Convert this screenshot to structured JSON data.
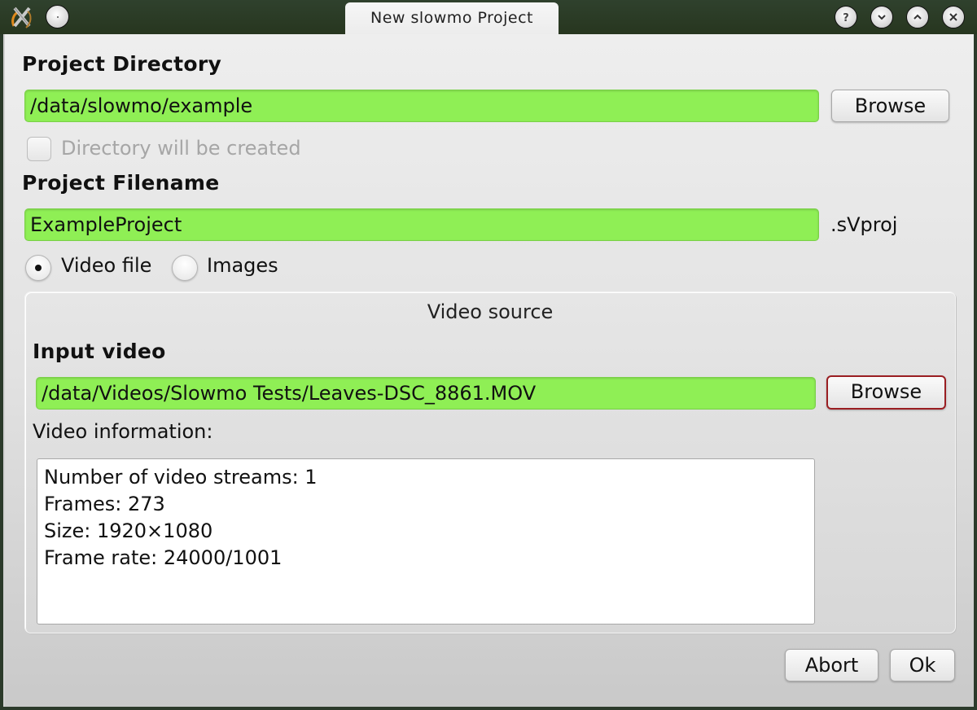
{
  "window": {
    "title": "New slowmo Project",
    "icons": {
      "app": "slowmo-app-logo-icon",
      "menu": "window-menu-icon",
      "help": "help-icon",
      "minimize": "minimize-icon",
      "maximize": "maximize-icon",
      "close": "close-icon"
    }
  },
  "project_directory": {
    "label": "Project Directory",
    "value": "/data/slowmo/example",
    "browse_label": "Browse",
    "create_checkbox": {
      "label": "Directory will be created",
      "checked": false,
      "enabled": false
    }
  },
  "project_filename": {
    "label": "Project Filename",
    "value": "ExampleProject",
    "extension": ".sVproj"
  },
  "source_type": {
    "options": [
      {
        "label": "Video file",
        "selected": true
      },
      {
        "label": "Images",
        "selected": false
      }
    ]
  },
  "video_source": {
    "group_title": "Video source",
    "input_label": "Input video",
    "input_value": "/data/Videos/Slowmo Tests/Leaves-DSC_8861.MOV",
    "browse_label": "Browse",
    "info_label": "Video information:",
    "info_lines": [
      "Number of video streams: 1",
      "Frames: 273",
      "Size: 1920×1080",
      "Frame rate: 24000/1001"
    ]
  },
  "footer": {
    "abort_label": "Abort",
    "ok_label": "Ok"
  },
  "colors": {
    "valid_field": "#8fef55",
    "focus_border": "#9a1e22",
    "titlebar": "#2b3a2a"
  }
}
